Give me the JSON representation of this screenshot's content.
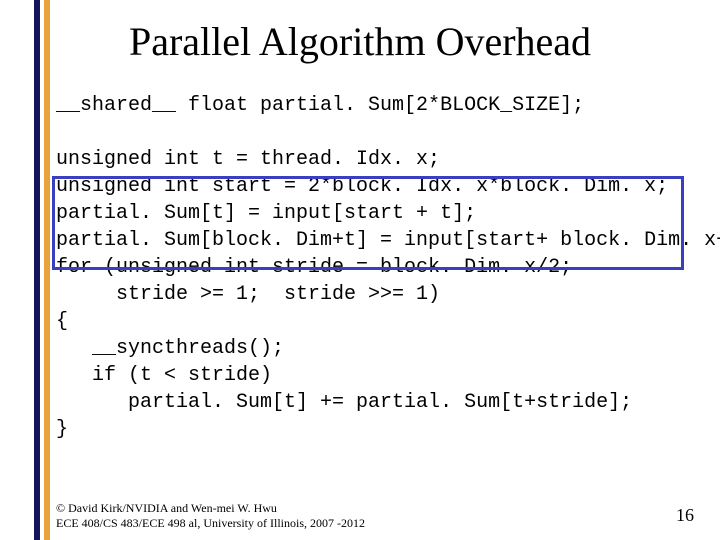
{
  "title": "Parallel Algorithm Overhead",
  "code": {
    "l1": "__shared__ float partial. Sum[2*BLOCK_SIZE];",
    "l2": "",
    "l3": "unsigned int t = thread. Idx. x;",
    "l4": "unsigned int start = 2*block. Idx. x*block. Dim. x;",
    "l5": "partial. Sum[t] = input[start + t];",
    "l6": "partial. Sum[block. Dim+t] = input[start+ block. Dim. x+t];",
    "l7": "for (unsigned int stride = block. Dim. x/2;",
    "l8": "     stride >= 1;  stride >>= 1)",
    "l9": "{",
    "l10": "   __syncthreads();",
    "l11": "   if (t < stride)",
    "l12": "      partial. Sum[t] += partial. Sum[t+stride];",
    "l13": "}"
  },
  "footer_line1": "© David Kirk/NVIDIA and Wen-mei W. Hwu",
  "footer_line2": "ECE 408/CS 483/ECE 498 al, University of Illinois, 2007 -2012",
  "page_number": "16"
}
